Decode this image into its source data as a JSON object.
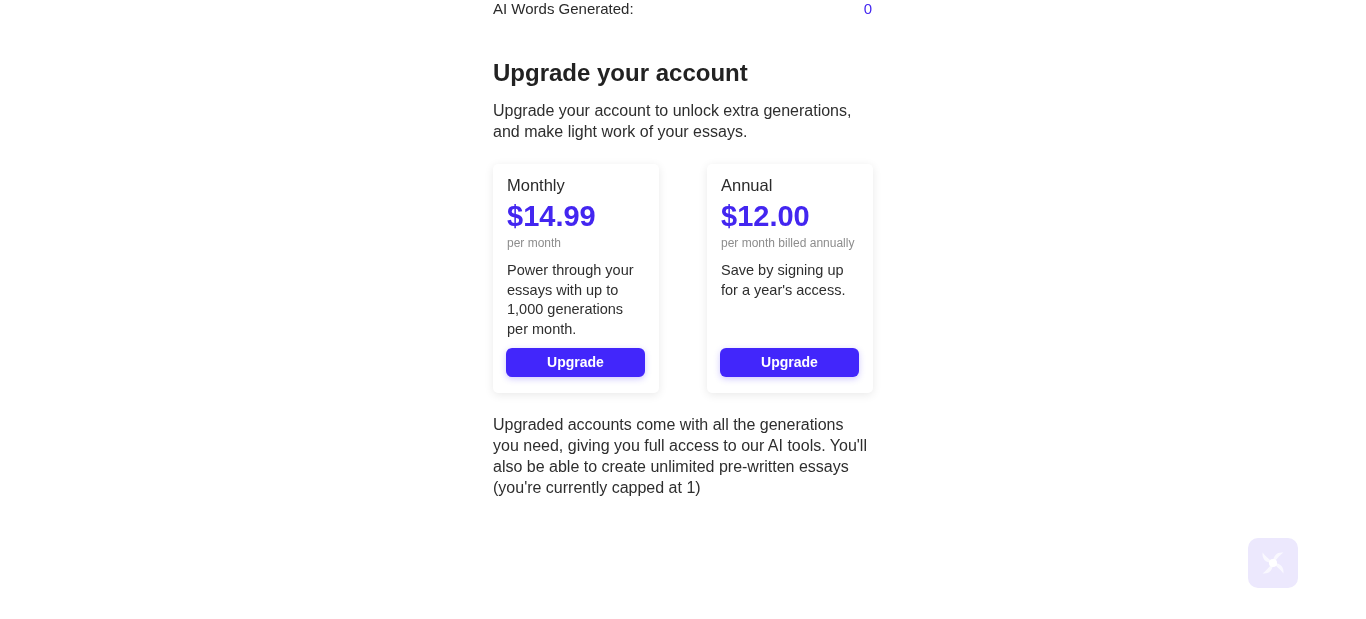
{
  "stats": [
    {
      "label": "AI Words Generated:",
      "value": "0"
    }
  ],
  "upgrade": {
    "title": "Upgrade your account",
    "intro": "Upgrade your account to unlock extra generations, and make light work of your essays.",
    "plans": [
      {
        "name": "Monthly",
        "price": "$14.99",
        "period": "per month",
        "description": "Power through your essays with up to 1,000 generations per month.",
        "button": "Upgrade"
      },
      {
        "name": "Annual",
        "price": "$12.00",
        "period": "per month billed annually",
        "description": "Save by signing up for a year's access.",
        "button": "Upgrade"
      }
    ],
    "footnote": "Upgraded accounts come with all the generations you need, giving you full access to our AI tools. You'll also be able to create unlimited pre-written essays (you're currently capped at 1)"
  }
}
